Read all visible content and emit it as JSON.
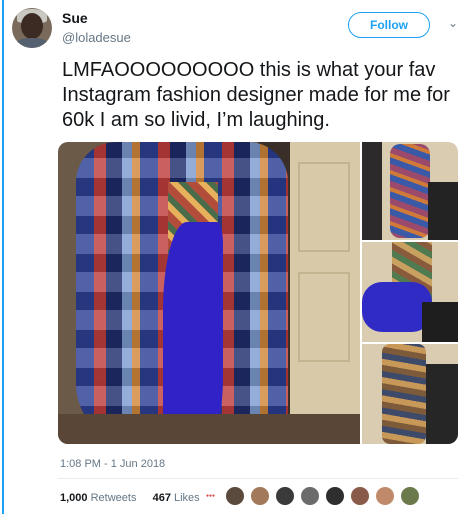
{
  "author": {
    "name": "Sue",
    "handle": "@loladesue",
    "follow_label": "Follow"
  },
  "tweet": {
    "text": "LMFAOOOOOOOOO this is what your fav Instagram fashion designer made for me for 60k I am so livid, I’m laughing.",
    "timestamp": "1:08 PM - 1 Jun 2018"
  },
  "stats": {
    "retweets_count": "1,000",
    "retweets_label": "Retweets",
    "likes_count": "467",
    "likes_label": "Likes"
  },
  "likers": [
    {
      "color": "#5a4a3e"
    },
    {
      "color": "#a07a5a"
    },
    {
      "color": "#3a3a3a"
    },
    {
      "color": "#6b6b6b"
    },
    {
      "color": "#2e2e2e"
    },
    {
      "color": "#8a5a4a"
    },
    {
      "color": "#c08a6a"
    },
    {
      "color": "#6a7a4a"
    }
  ],
  "icons": {
    "more": "chevron-down-icon"
  },
  "colors": {
    "accent": "#1da1f2",
    "text": "#14171a",
    "muted": "#657786"
  }
}
